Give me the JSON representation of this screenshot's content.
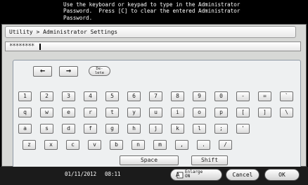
{
  "message": {
    "line1": "Use the keyboard or keypad to type in the Administrator",
    "line2": "Password.  Press [C] to clear the entered Administrator",
    "line3": "Password."
  },
  "breadcrumb": "Utility > Administrator Settings",
  "password_field": {
    "value": "********"
  },
  "keyboard": {
    "nav_row": {
      "left_arrow": "←",
      "right_arrow": "→",
      "delete_line1": "De-",
      "delete_line2": "lete"
    },
    "row1": [
      "1",
      "2",
      "3",
      "4",
      "5",
      "6",
      "7",
      "8",
      "9",
      "0",
      "-",
      "=",
      "`"
    ],
    "row2": [
      "q",
      "w",
      "e",
      "r",
      "t",
      "y",
      "u",
      "i",
      "o",
      "p",
      "[",
      "]",
      "\\"
    ],
    "row3": [
      "a",
      "s",
      "d",
      "f",
      "g",
      "h",
      "j",
      "k",
      "l",
      ";",
      "'"
    ],
    "row4": [
      "z",
      "x",
      "c",
      "v",
      "b",
      "n",
      "m",
      ",",
      ".",
      "/"
    ],
    "space_label": "Space",
    "shift_label": "Shift"
  },
  "status_bar": {
    "date": "01/11/2012",
    "time": "08:11"
  },
  "footer": {
    "enlarge_line1": "Enlarge",
    "enlarge_line2": "ON",
    "cancel_label": "Cancel",
    "ok_label": "OK"
  },
  "icons": {
    "enlarge": "enlarge-display-icon"
  }
}
